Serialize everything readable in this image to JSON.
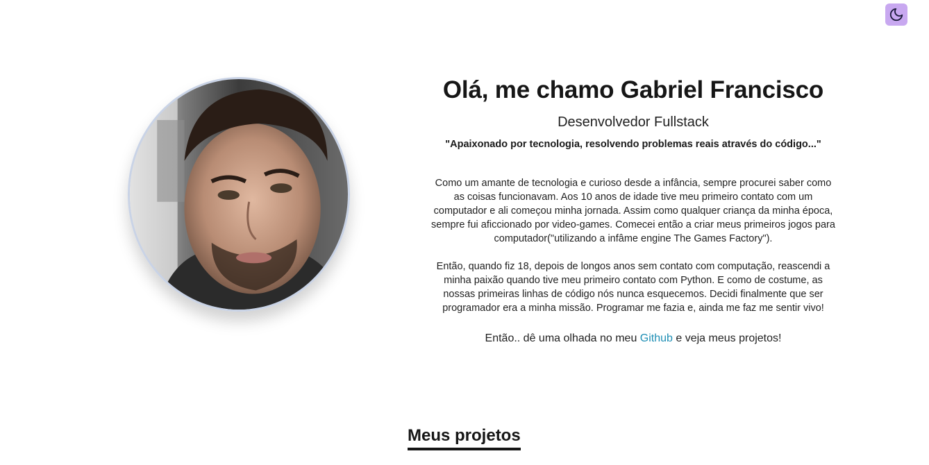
{
  "theme_toggle": {
    "icon": "moon-icon",
    "color": "#c8a8f0"
  },
  "profile": {
    "photo_alt": "Foto de Gabriel Francisco"
  },
  "intro": {
    "title": "Olá, me chamo Gabriel Francisco",
    "role": "Desenvolvedor Fullstack",
    "quote": "\"Apaixonado por tecnologia, resolvendo problemas reais através do código...\"",
    "paragraphs": [
      "Como um amante de tecnologia e curioso desde a infância, sempre procurei saber como as coisas funcionavam. Aos 10 anos de idade tive meu primeiro contato com um computador e ali começou minha jornada. Assim como qualquer criança da minha época, sempre fui aficcionado por video-games. Comecei então a criar meus primeiros jogos para computador(\"utilizando a infâme engine The Games Factory\").",
      "Então, quando fiz 18, depois de longos anos sem contato com computação, reascendi a minha paixão quando tive meu primeiro contato com Python. E como de costume, as nossas primeiras linhas de código nós nunca esquecemos. Decidi finalmente que ser programador era a minha missão. Programar me fazia e, ainda me faz me sentir vivo!"
    ],
    "cta_before": "Então.. dê uma olhada no meu ",
    "cta_link": "Github",
    "cta_after": " e veja meus projetos!",
    "link_color": "#1f8fb5"
  },
  "projects": {
    "title": "Meus projetos"
  }
}
